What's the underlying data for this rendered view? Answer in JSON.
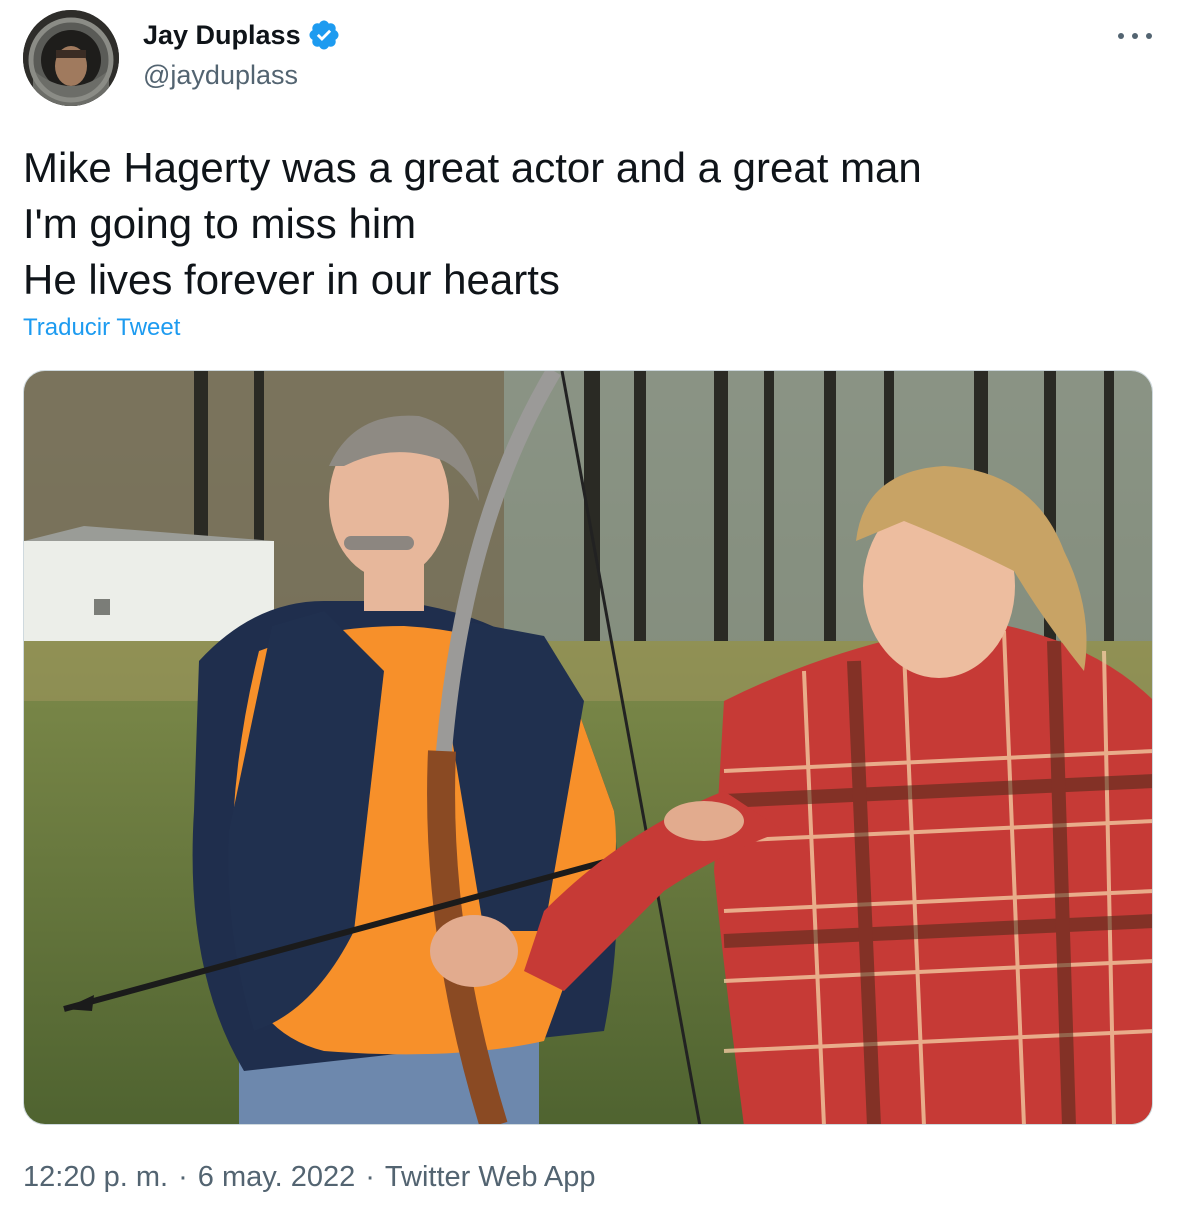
{
  "user": {
    "display_name": "Jay Duplass",
    "handle": "@jayduplass",
    "verified": true,
    "avatar_icon": "avatar-astronaut-helmet"
  },
  "tweet": {
    "lines": [
      "Mike Hagerty was a great actor and a great man",
      "I'm going to miss him",
      "He lives forever in our hearts"
    ],
    "translate_label": "Traducir Tweet",
    "media_icon": "photo-two-people-archery-field"
  },
  "meta": {
    "time": "12:20 p. m.",
    "separator": "·",
    "date": "6 may. 2022",
    "source": "Twitter Web App"
  },
  "icons": {
    "more": "more-horizontal-icon",
    "verified": "verified-badge-icon"
  },
  "colors": {
    "accent": "#1d9bf0",
    "text": "#0f1419",
    "secondary": "#536471",
    "border": "#cfd9de"
  }
}
